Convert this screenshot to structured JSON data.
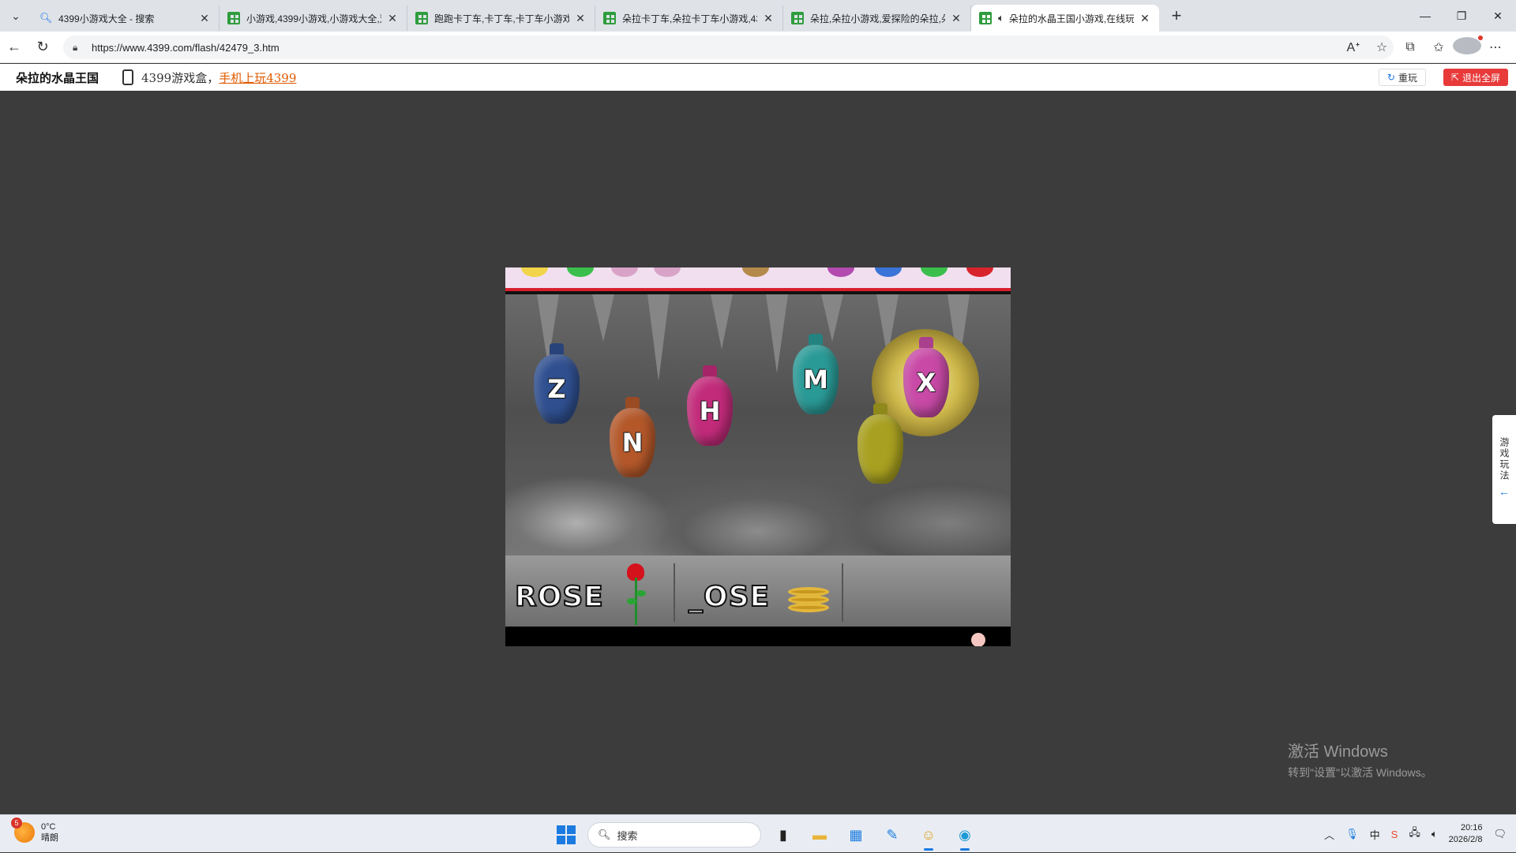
{
  "browser": {
    "tabs": [
      {
        "title": "4399小游戏大全 - 搜索",
        "icon": "search-icon",
        "active": false
      },
      {
        "title": "小游戏,4399小游戏,小游戏大全,双",
        "icon": "site-grid-icon",
        "active": false
      },
      {
        "title": "跑跑卡丁车,卡丁车,卡丁车小游戏,",
        "icon": "site-grid-icon",
        "active": false
      },
      {
        "title": "朵拉卡丁车,朵拉卡丁车小游戏,439",
        "icon": "site-grid-icon",
        "active": false
      },
      {
        "title": "朵拉,朵拉小游戏,爱探险的朵拉,朵",
        "icon": "site-grid-icon",
        "active": false
      },
      {
        "title": "朵拉的水晶王国小游戏,在线玩",
        "icon": "site-grid-icon",
        "active": true,
        "audio": true
      }
    ],
    "url": "https://www.4399.com/flash/42479_3.htm"
  },
  "site": {
    "game_title": "朵拉的水晶王国",
    "box_text": "4399游戏盒，",
    "box_link": "手机上玩4399",
    "replay_label": "重玩",
    "exit_label": "退出全屏"
  },
  "game": {
    "gems": [
      {
        "letter": "Z",
        "color": "#2f4f8f"
      },
      {
        "letter": "N",
        "color": "#b4582a"
      },
      {
        "letter": "H",
        "color": "#c22b7a"
      },
      {
        "letter": "M",
        "color": "#2a9a96"
      },
      {
        "letter": "X",
        "color": "#c84aa6",
        "highlighted": true
      },
      {
        "letter": "",
        "color": "#a8a020"
      }
    ],
    "words": [
      {
        "text": "ROSE",
        "picture": "rose-icon"
      },
      {
        "text": "_OSE",
        "picture": "hose-icon"
      }
    ]
  },
  "side_help": {
    "label": "游戏玩法"
  },
  "watermark": {
    "line1": "激活 Windows",
    "line2": "转到\"设置\"以激活 Windows。"
  },
  "taskbar": {
    "weather_badge": "5",
    "temperature": "0°C",
    "condition": "晴朗",
    "search_placeholder": "搜索",
    "ime": "中",
    "time": "20:16",
    "date": "2026/2/8"
  }
}
